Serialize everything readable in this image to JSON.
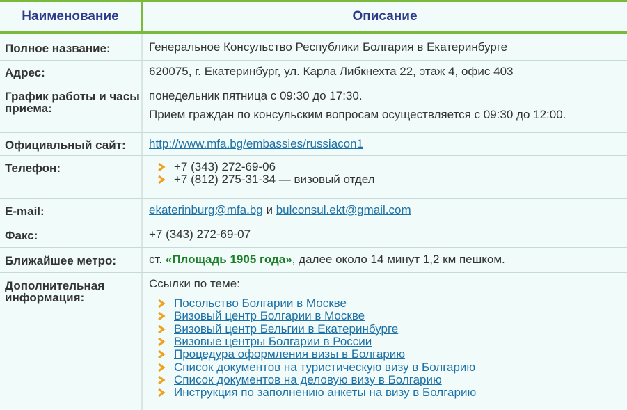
{
  "header": {
    "col_name": "Наименование",
    "col_desc": "Описание"
  },
  "rows": {
    "full_name": {
      "label": "Полное название:",
      "value": "Генеральное Консульство Республики Болгария в Екатеринбурге"
    },
    "address": {
      "label": "Адрес:",
      "value": "620075, г. Екатеринбург, ул. Карла Либкнехта 22, этаж 4, офис 403"
    },
    "schedule": {
      "label": "График работы и часы приема:",
      "line1": "понедельник пятница с 09:30 до 17:30.",
      "line2": "Прием граждан по консульским вопросам осуществляется с 09:30 до 12:00."
    },
    "website": {
      "label": "Официальный сайт:",
      "link": "http://www.mfa.bg/embassies/russiacon1"
    },
    "phone": {
      "label": "Телефон:",
      "items": [
        "+7 (343) 272-69-06",
        "+7 (812) 275-31-34 — визовый отдел"
      ]
    },
    "email": {
      "label": "E-mail:",
      "email1": "ekaterinburg@mfa.bg",
      "sep": " и ",
      "email2": "bulconsul.ekt@gmail.com"
    },
    "fax": {
      "label": "Факс:",
      "value": "+7 (343) 272-69-07"
    },
    "metro": {
      "label": "Ближайшее метро:",
      "prefix": "ст. ",
      "station": "«Площадь 1905 года»",
      "suffix": ", далее около 14 минут 1,2 км пешком."
    },
    "additional": {
      "label": "Дополнительная информация:",
      "intro": "Ссылки по теме:",
      "links": [
        "Посольство Болгарии в Москве",
        "Визовый центр Болгарии в Москве",
        "Визовый центр Бельгии в Екатеринбурге",
        "Визовые центры Болгарии в России",
        "Процедура оформления визы в Болгарию",
        "Список документов на туристическую визу в Болгарию",
        "Список документов на деловую визу в Болгарию",
        "Инструкция по заполнению анкеты на визу в Болгарию"
      ]
    }
  },
  "colors": {
    "accent_green": "#79b93c",
    "header_text": "#2f3a8c",
    "link": "#1d71a6",
    "metro": "#1d7f28",
    "bullet": "#f0a11e",
    "background": "#f0fbfa"
  },
  "icons": {
    "bullet": "chevron-right-icon"
  }
}
